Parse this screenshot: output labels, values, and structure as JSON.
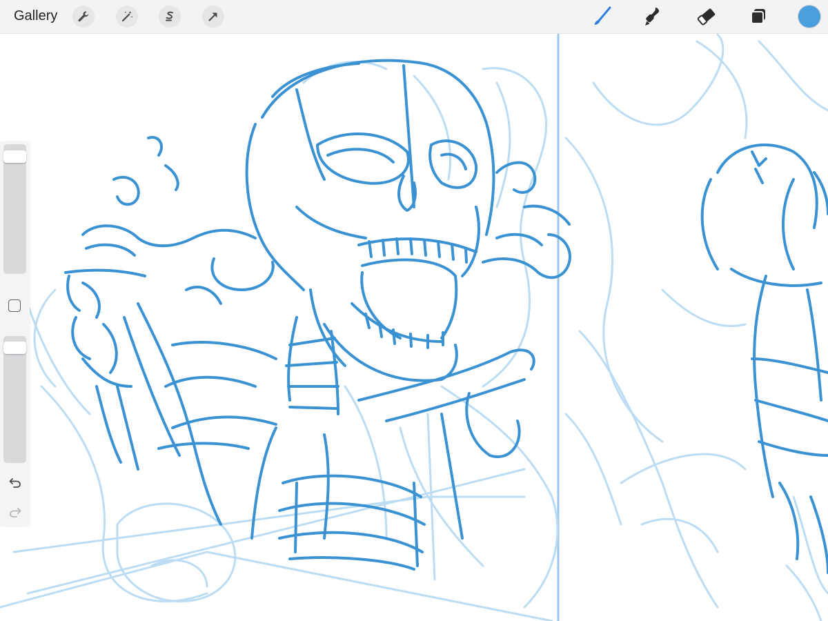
{
  "toolbar": {
    "gallery_label": "Gallery",
    "left_tools": [
      "wrench-icon",
      "magic-wand-icon",
      "selection-s-icon",
      "transform-arrow-icon"
    ],
    "right_tools": [
      "brush-icon",
      "smudge-icon",
      "eraser-icon",
      "layers-icon"
    ],
    "active_tool": "brush-icon",
    "accent_color": "#2e7fe0",
    "current_color": "#4a9fde"
  },
  "sidebar": {
    "brush_size": 0.95,
    "brush_opacity": 0.95,
    "controls": [
      "modify-square-icon",
      "undo-icon",
      "redo-icon"
    ]
  },
  "canvas": {
    "stroke_color_dark": "#3a8fd0",
    "stroke_color_light": "#b9dcf4"
  }
}
